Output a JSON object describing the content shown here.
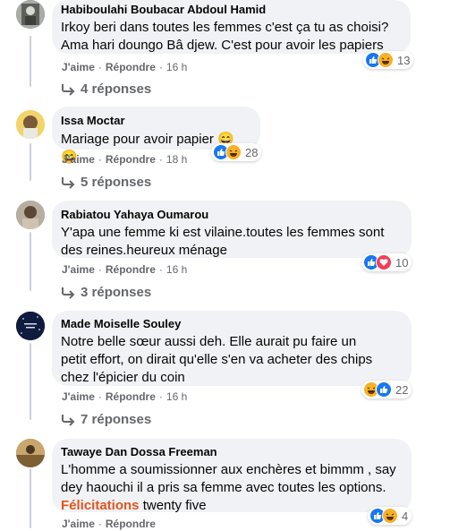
{
  "comments": [
    {
      "author": "Habiboulahi Boubacar Abdoul Hamid",
      "text": "Irkoy beri dans toutes les femmes c'est ça tu as choisi? Ama hari doungo Bâ djew. C'est pour avoir les papiers",
      "like": "J'aime",
      "reply": "Répondre",
      "time": "16 h",
      "reaction_icons": [
        "like-icon",
        "haha-icon"
      ],
      "reaction_count": "13",
      "replies_label": "4 réponses"
    },
    {
      "author": "Issa Moctar",
      "text": "Mariage pour avoir papier 😄😄",
      "like": "J'aime",
      "reply": "Répondre",
      "time": "18 h",
      "reaction_icons": [
        "like-icon",
        "haha-icon"
      ],
      "reaction_count": "28",
      "replies_label": "5 réponses"
    },
    {
      "author": "Rabiatou Yahaya Oumarou",
      "text": "Y'apa une femme ki est vilaine.toutes les femmes sont des reines.heureux ménage",
      "like": "J'aime",
      "reply": "Répondre",
      "time": "16 h",
      "reaction_icons": [
        "like-icon",
        "love-icon"
      ],
      "reaction_count": "10",
      "replies_label": "3 réponses"
    },
    {
      "author": "Made Moiselle Souley",
      "text": "Notre belle sœur aussi deh. Elle aurait pu faire un petit effort, on dirait qu'elle s'en va acheter des chips chez l'épicier du coin",
      "like": "J'aime",
      "reply": "Répondre",
      "time": "16 h",
      "reaction_icons": [
        "haha-icon",
        "like-icon"
      ],
      "reaction_count": "22",
      "replies_label": "7 réponses"
    },
    {
      "author": "Tawaye Dan Dossa Freeman",
      "text": "L'homme a soumissionner aux enchères et bimmm , say dey haouchi il a pris sa femme avec toutes les options.",
      "mention": "Félicitations",
      "text_after_mention": " twenty five",
      "like": "J'aime",
      "reply": "Répondre",
      "reaction_icons": [
        "like-icon",
        "haha-icon"
      ],
      "reaction_count": "4"
    }
  ],
  "colors": {
    "bubble": "#f0f2f5",
    "meta": "#65676b",
    "like_reaction": "#1877f2",
    "haha_reaction": "#f7b125",
    "love_reaction": "#f33e58",
    "mention": "#e1551f"
  }
}
